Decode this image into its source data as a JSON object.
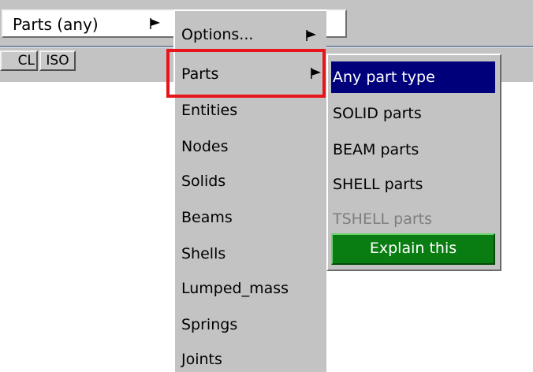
{
  "selector": {
    "label": "Parts (any)",
    "arrow_icon": "triangle-flag-right-icon"
  },
  "toolbar": {
    "buttons": [
      "CL",
      "ISO"
    ]
  },
  "menu": {
    "items": [
      {
        "label": "Options...",
        "has_submenu": true
      },
      {
        "label": "Parts",
        "has_submenu": true
      },
      {
        "label": "Entities",
        "has_submenu": false
      },
      {
        "label": "Nodes",
        "has_submenu": false
      },
      {
        "label": "Solids",
        "has_submenu": false
      },
      {
        "label": "Beams",
        "has_submenu": false
      },
      {
        "label": "Shells",
        "has_submenu": false
      },
      {
        "label": "Lumped_mass",
        "has_submenu": false
      },
      {
        "label": "Springs",
        "has_submenu": false
      },
      {
        "label": "Joints",
        "has_submenu": false
      }
    ]
  },
  "submenu": {
    "items": [
      {
        "label": "Any part type",
        "state": "selected"
      },
      {
        "label": "SOLID parts",
        "state": "normal"
      },
      {
        "label": "BEAM parts",
        "state": "normal"
      },
      {
        "label": "SHELL parts",
        "state": "normal"
      },
      {
        "label": "TSHELL parts",
        "state": "disabled"
      }
    ],
    "explain_label": "Explain this"
  },
  "colors": {
    "menu_background": "#c3c3c3",
    "selected_background": "#00007b",
    "explain_background": "#0a7d12",
    "highlight_border": "#e8141c",
    "disabled_text": "#7e7e7e"
  }
}
